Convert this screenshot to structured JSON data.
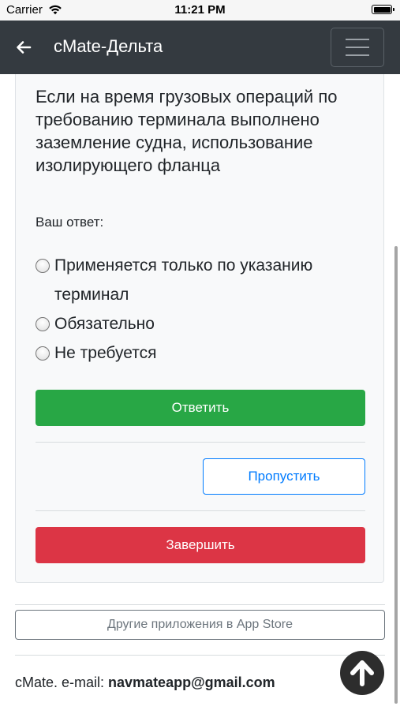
{
  "status_bar": {
    "carrier": "Carrier",
    "time": "11:21 PM",
    "icons": [
      "wifi-icon",
      "battery-icon"
    ]
  },
  "navbar": {
    "title": "cMate-Дельта",
    "back_icon": "arrow-left-icon",
    "menu_icon": "hamburger-menu-icon",
    "background": "#343a40"
  },
  "question": {
    "text": "Если на время грузовых операций по требованию терминала выполнено заземление судна, использование изолирующего фланца",
    "answer_label": "Ваш ответ:",
    "options": [
      {
        "label": "Применяется только по указанию терминал",
        "selected": false
      },
      {
        "label": "Обязательно",
        "selected": false
      },
      {
        "label": "Не требуется",
        "selected": false
      }
    ]
  },
  "actions": {
    "submit_label": "Ответить",
    "skip_label": "Пропустить",
    "finish_label": "Завершить"
  },
  "footer": {
    "appstore_label": "Другие приложения в App Store",
    "contact_prefix": "cMate. e-mail: ",
    "email": "navmateapp@gmail.com",
    "scroll_top_icon": "arrow-up-circle-icon"
  },
  "colors": {
    "submit": "#28a745",
    "skip": "#007bff",
    "finish": "#dc3545",
    "appstore": "#6c757d"
  }
}
